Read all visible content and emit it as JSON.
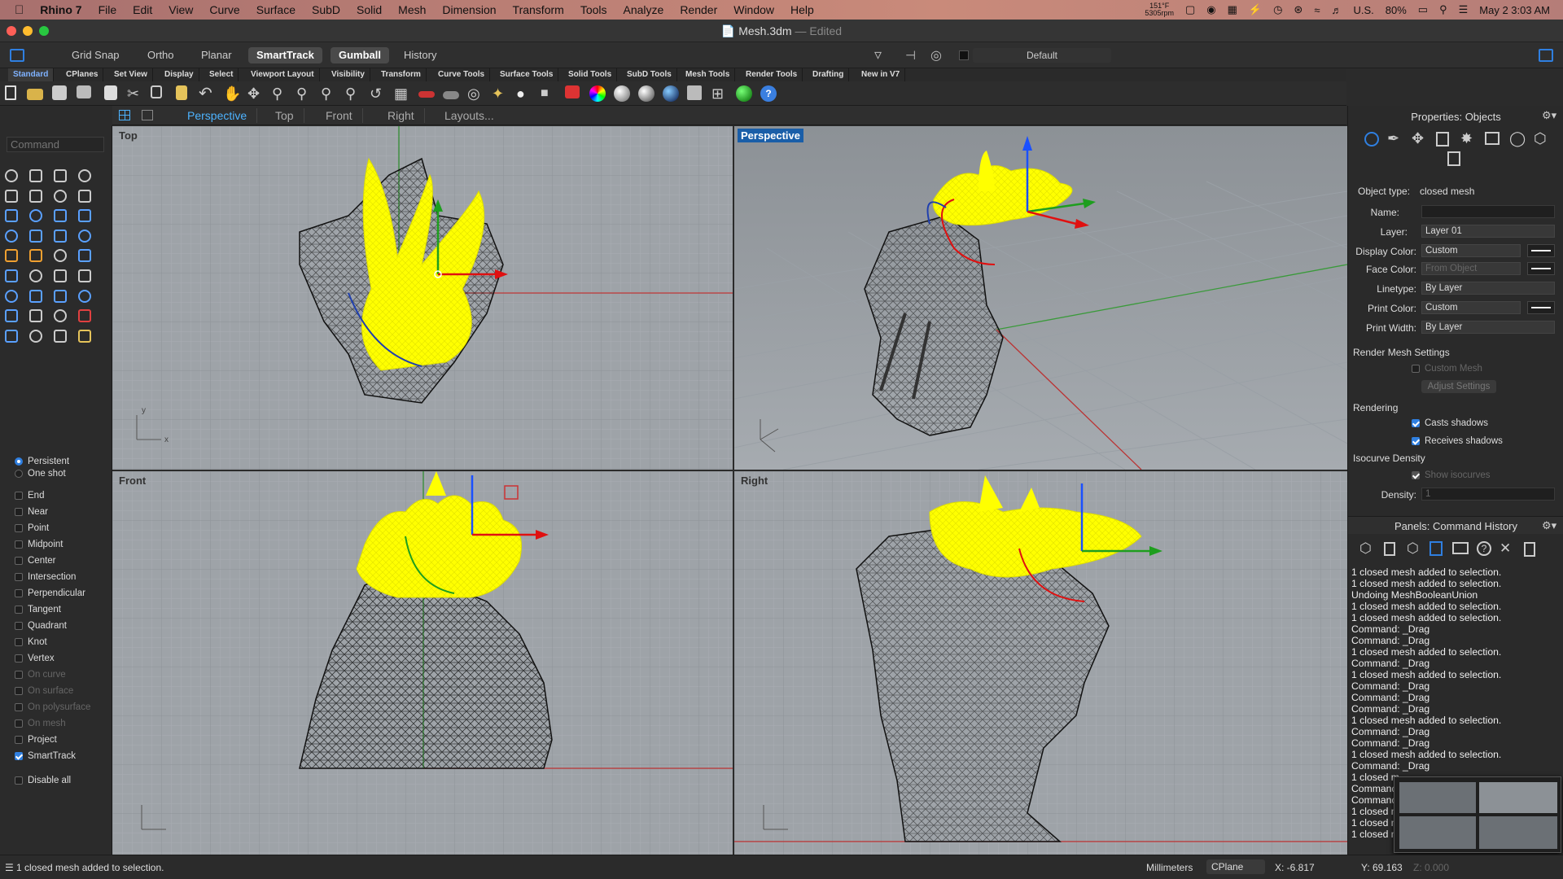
{
  "menubar": {
    "apple_icon": "apple-icon",
    "app": "Rhino 7",
    "items": [
      "File",
      "Edit",
      "View",
      "Curve",
      "Surface",
      "SubD",
      "Solid",
      "Mesh",
      "Dimension",
      "Transform",
      "Tools",
      "Analyze",
      "Render",
      "Window",
      "Help"
    ],
    "temp": "151°F",
    "fan": "5305rpm",
    "keyboard": "U.S.",
    "battery": "80%",
    "clock": "May 2  3:03 AM"
  },
  "window": {
    "title": "Mesh.3dm",
    "edited": "— Edited"
  },
  "toolbar": {
    "toggles": [
      "Grid Snap",
      "Ortho",
      "Planar",
      "SmartTrack",
      "Gumball",
      "History"
    ],
    "layer": "Default"
  },
  "tabs": [
    "Standard",
    "CPlanes",
    "Set View",
    "Display",
    "Select",
    "Viewport Layout",
    "Visibility",
    "Transform",
    "Curve Tools",
    "Surface Tools",
    "Solid Tools",
    "SubD Tools",
    "Mesh Tools",
    "Render Tools",
    "Drafting",
    "New in V7"
  ],
  "viewport_tabs": [
    "Perspective",
    "Top",
    "Front",
    "Right",
    "Layouts..."
  ],
  "command_placeholder": "Command",
  "osnaps": {
    "persistent": "Persistent",
    "oneshot": "One shot",
    "items": [
      {
        "label": "End",
        "checked": false,
        "disabled": false
      },
      {
        "label": "Near",
        "checked": false,
        "disabled": false
      },
      {
        "label": "Point",
        "checked": false,
        "disabled": false
      },
      {
        "label": "Midpoint",
        "checked": false,
        "disabled": false
      },
      {
        "label": "Center",
        "checked": false,
        "disabled": false
      },
      {
        "label": "Intersection",
        "checked": false,
        "disabled": false
      },
      {
        "label": "Perpendicular",
        "checked": false,
        "disabled": false
      },
      {
        "label": "Tangent",
        "checked": false,
        "disabled": false
      },
      {
        "label": "Quadrant",
        "checked": false,
        "disabled": false
      },
      {
        "label": "Knot",
        "checked": false,
        "disabled": false
      },
      {
        "label": "Vertex",
        "checked": false,
        "disabled": false
      },
      {
        "label": "On curve",
        "checked": false,
        "disabled": true
      },
      {
        "label": "On surface",
        "checked": false,
        "disabled": true
      },
      {
        "label": "On polysurface",
        "checked": false,
        "disabled": true
      },
      {
        "label": "On mesh",
        "checked": false,
        "disabled": true
      },
      {
        "label": "Project",
        "checked": false,
        "disabled": false
      },
      {
        "label": "SmartTrack",
        "checked": true,
        "disabled": false
      }
    ],
    "disable_all": "Disable all"
  },
  "viewports": {
    "top": "Top",
    "perspective": "Perspective",
    "front": "Front",
    "right": "Right"
  },
  "properties": {
    "header": "Properties: Objects",
    "object_type_label": "Object type:",
    "object_type": "closed mesh",
    "name_label": "Name:",
    "name": "",
    "layer_label": "Layer:",
    "layer": "Layer 01",
    "display_color_label": "Display Color:",
    "display_color": "Custom",
    "face_color_label": "Face Color:",
    "face_color": "From Object",
    "linetype_label": "Linetype:",
    "linetype": "By Layer",
    "print_color_label": "Print Color:",
    "print_color": "Custom",
    "print_width_label": "Print Width:",
    "print_width": "By Layer",
    "render_mesh_header": "Render Mesh Settings",
    "custom_mesh": "Custom Mesh",
    "adjust_settings": "Adjust Settings",
    "rendering_header": "Rendering",
    "casts_shadows": "Casts shadows",
    "receives_shadows": "Receives shadows",
    "isocurve_header": "Isocurve Density",
    "show_isocurves": "Show isocurves",
    "density_label": "Density:",
    "density": "1"
  },
  "history": {
    "header": "Panels: Command History",
    "lines": [
      "1 closed mesh added to selection.",
      "1 closed mesh added to selection.",
      "Undoing MeshBooleanUnion",
      "1 closed mesh added to selection.",
      "1 closed mesh added to selection.",
      "Command: _Drag",
      "Command: _Drag",
      "1 closed mesh added to selection.",
      "Command: _Drag",
      "1 closed mesh added to selection.",
      "Command: _Drag",
      "Command: _Drag",
      "Command: _Drag",
      "1 closed mesh added to selection.",
      "Command: _Drag",
      "Command: _Drag",
      "1 closed mesh added to selection.",
      "Command: _Drag",
      "1 closed m",
      "Command:",
      "Command:",
      "1 closed m",
      "1 closed m",
      "1 closed m"
    ]
  },
  "status": {
    "message": "1 closed mesh added to selection.",
    "units": "Millimeters",
    "cplane": "CPlane",
    "x": "X: -6.817",
    "y": "Y: 69.163",
    "z": "Z: 0.000"
  },
  "colors": {
    "accent": "#2f7fe0",
    "selection": "#ffff00",
    "viewport_bg": "#9ea3a8",
    "active_viewport_label": "#1a5ea8"
  }
}
